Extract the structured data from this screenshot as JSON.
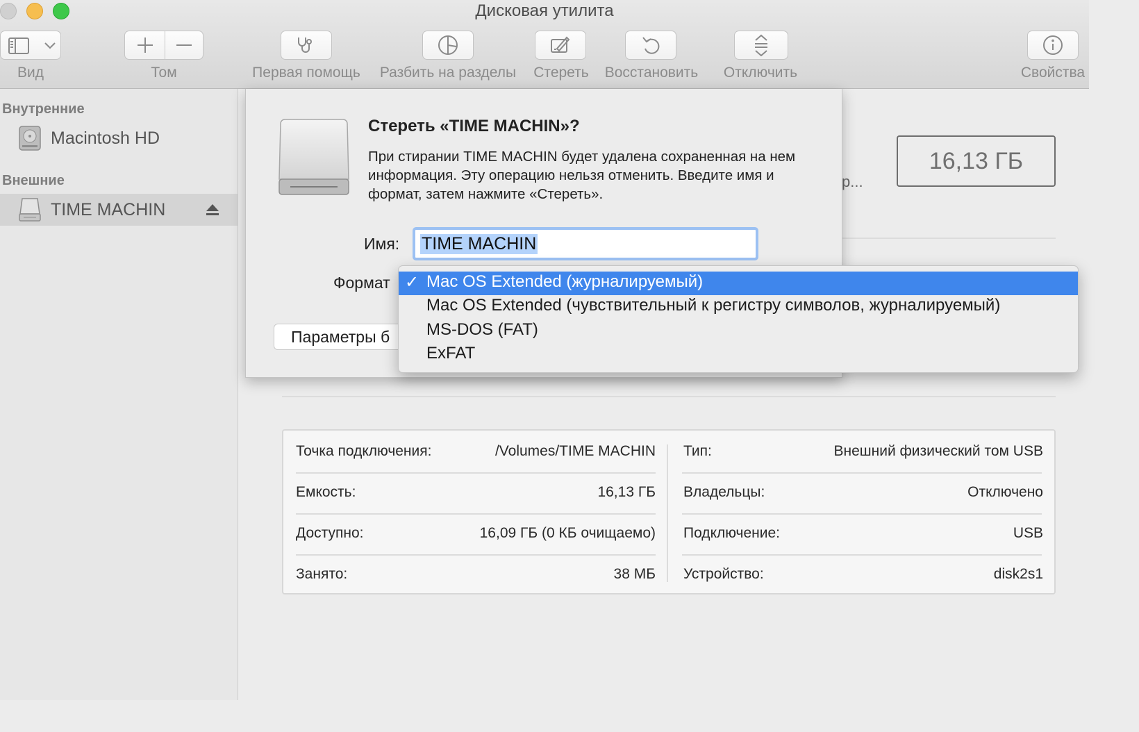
{
  "window": {
    "title": "Дисковая утилита"
  },
  "toolbar": {
    "view_label": "Вид",
    "volume_label": "Том",
    "first_aid_label": "Первая помощь",
    "partition_label": "Разбить на разделы",
    "erase_label": "Стереть",
    "restore_label": "Восстановить",
    "unmount_label": "Отключить",
    "info_label": "Свойства"
  },
  "sidebar": {
    "internal_header": "Внутренние",
    "external_header": "Внешние",
    "items": [
      {
        "label": "Macintosh HD",
        "icon": "internal-disk-icon"
      },
      {
        "label": "TIME MACHIN",
        "icon": "external-disk-icon",
        "selected": true
      }
    ]
  },
  "main": {
    "capacity": "16,13 ГБ",
    "truncated_text": "р..."
  },
  "dialog": {
    "title": "Стереть «TIME MACHIN»?",
    "message": "При стирании TIME MACHIN будет удалена сохраненная на нем информация. Эту операцию нельзя отменить. Введите имя и формат, затем нажмите «Стереть».",
    "name_label": "Имя:",
    "name_value": "TIME MACHIN",
    "format_label": "Формат",
    "params_button": "Параметры б"
  },
  "format_menu": {
    "check_glyph": "✓",
    "options": [
      "Mac OS Extended (журналируемый)",
      "Mac OS Extended (чувствительный к регистру символов, журналируемый)",
      "MS-DOS (FAT)",
      "ExFAT"
    ],
    "selected_index": 0
  },
  "info": {
    "left": [
      {
        "key": "Точка подключения:",
        "value": "/Volumes/TIME MACHIN"
      },
      {
        "key": "Емкость:",
        "value": "16,13 ГБ"
      },
      {
        "key": "Доступно:",
        "value": "16,09 ГБ (0 КБ очищаемо)"
      },
      {
        "key": "Занято:",
        "value": "38 МБ"
      }
    ],
    "right": [
      {
        "key": "Тип:",
        "value": "Внешний физический том USB"
      },
      {
        "key": "Владельцы:",
        "value": "Отключено"
      },
      {
        "key": "Подключение:",
        "value": "USB"
      },
      {
        "key": "Устройство:",
        "value": "disk2s1"
      }
    ]
  },
  "colors": {
    "accent": "#3f86ec",
    "selection_text": "#b4d3fb",
    "close": "#d0d0d0",
    "minimize": "#f6be4f",
    "maximize": "#3ec84a"
  }
}
